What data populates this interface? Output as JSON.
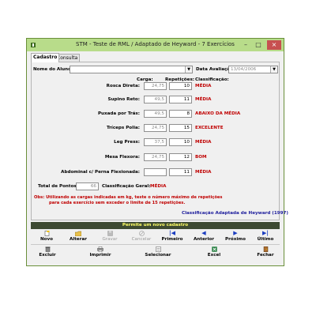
{
  "window": {
    "title": "STM - Teste de RML / Adaptado de Heyward - 7 Exercícios"
  },
  "tabs": [
    {
      "label": "Cadastro"
    },
    {
      "label": "Consulta"
    }
  ],
  "form": {
    "aluno_label": "Nome do Aluno:",
    "aluno_value": "",
    "data_label": "Data Avaliação:",
    "data_value": "13/04/2006",
    "headers": {
      "carga": "Carga:",
      "repeticoes": "Repetições:",
      "classificacao": "Classificação:"
    },
    "exercises": [
      {
        "label": "Rosca Direta:",
        "carga": "24,75",
        "reps": "10",
        "class": "MÉDIA"
      },
      {
        "label": "Supino Reto:",
        "carga": "49,5",
        "reps": "11",
        "class": "MÉDIA"
      },
      {
        "label": "Puxada por Trás:",
        "carga": "49,5",
        "reps": "8",
        "class": "ABAIXO DA MÉDIA"
      },
      {
        "label": "Tríceps Polia:",
        "carga": "24,75",
        "reps": "15",
        "class": "EXCELENTE"
      },
      {
        "label": "Leg Press:",
        "carga": "37,5",
        "reps": "10",
        "class": "MÉDIA"
      },
      {
        "label": "Mesa Flexora:",
        "carga": "24,75",
        "reps": "12",
        "class": "BOM"
      },
      {
        "label": "Abdominal c/ Perna Flexionada:",
        "carga": "",
        "reps": "11",
        "class": "MÉDIA"
      }
    ],
    "total_label": "Total de Pontos:",
    "total_value": "66",
    "geral_label": "Classificação Geral:",
    "geral_value": "MÉDIA",
    "obs_line1": "Obs:  Utilizando as cargas indicadas em kg, teste o número máximo de repetições",
    "obs_line2": "para cada exercício sem exceder o limite de 15 repetições.",
    "footer_link": "Classificação Adaptada de Heyward (1997)"
  },
  "status_bar": "Permite um novo cadastro",
  "nav_buttons": [
    {
      "label": "Novo",
      "icon": "new-document-icon",
      "enabled": true
    },
    {
      "label": "Alterar",
      "icon": "edit-folder-icon",
      "enabled": true
    },
    {
      "label": "Gravar",
      "icon": "save-icon",
      "enabled": false
    },
    {
      "label": "Cancelar",
      "icon": "cancel-icon",
      "enabled": false
    },
    {
      "label": "Primeiro",
      "icon": "first-record-icon",
      "enabled": true
    },
    {
      "label": "Anterior",
      "icon": "previous-record-icon",
      "enabled": true
    },
    {
      "label": "Próximo",
      "icon": "next-record-icon",
      "enabled": true
    },
    {
      "label": "Último",
      "icon": "last-record-icon",
      "enabled": true
    }
  ],
  "action_buttons": [
    {
      "label": "Excluir",
      "icon": "delete-icon"
    },
    {
      "label": "Imprimir",
      "icon": "print-icon"
    },
    {
      "label": "Selecionar",
      "icon": "select-icon"
    },
    {
      "label": "Excel",
      "icon": "excel-icon"
    },
    {
      "label": "Fechar",
      "icon": "close-door-icon"
    }
  ],
  "colors": {
    "titlebar": "#b8dc8a",
    "classification": "#c00000",
    "status_bg": "#3d4a32",
    "status_text": "#ffff66",
    "link": "#1c1c9c"
  }
}
